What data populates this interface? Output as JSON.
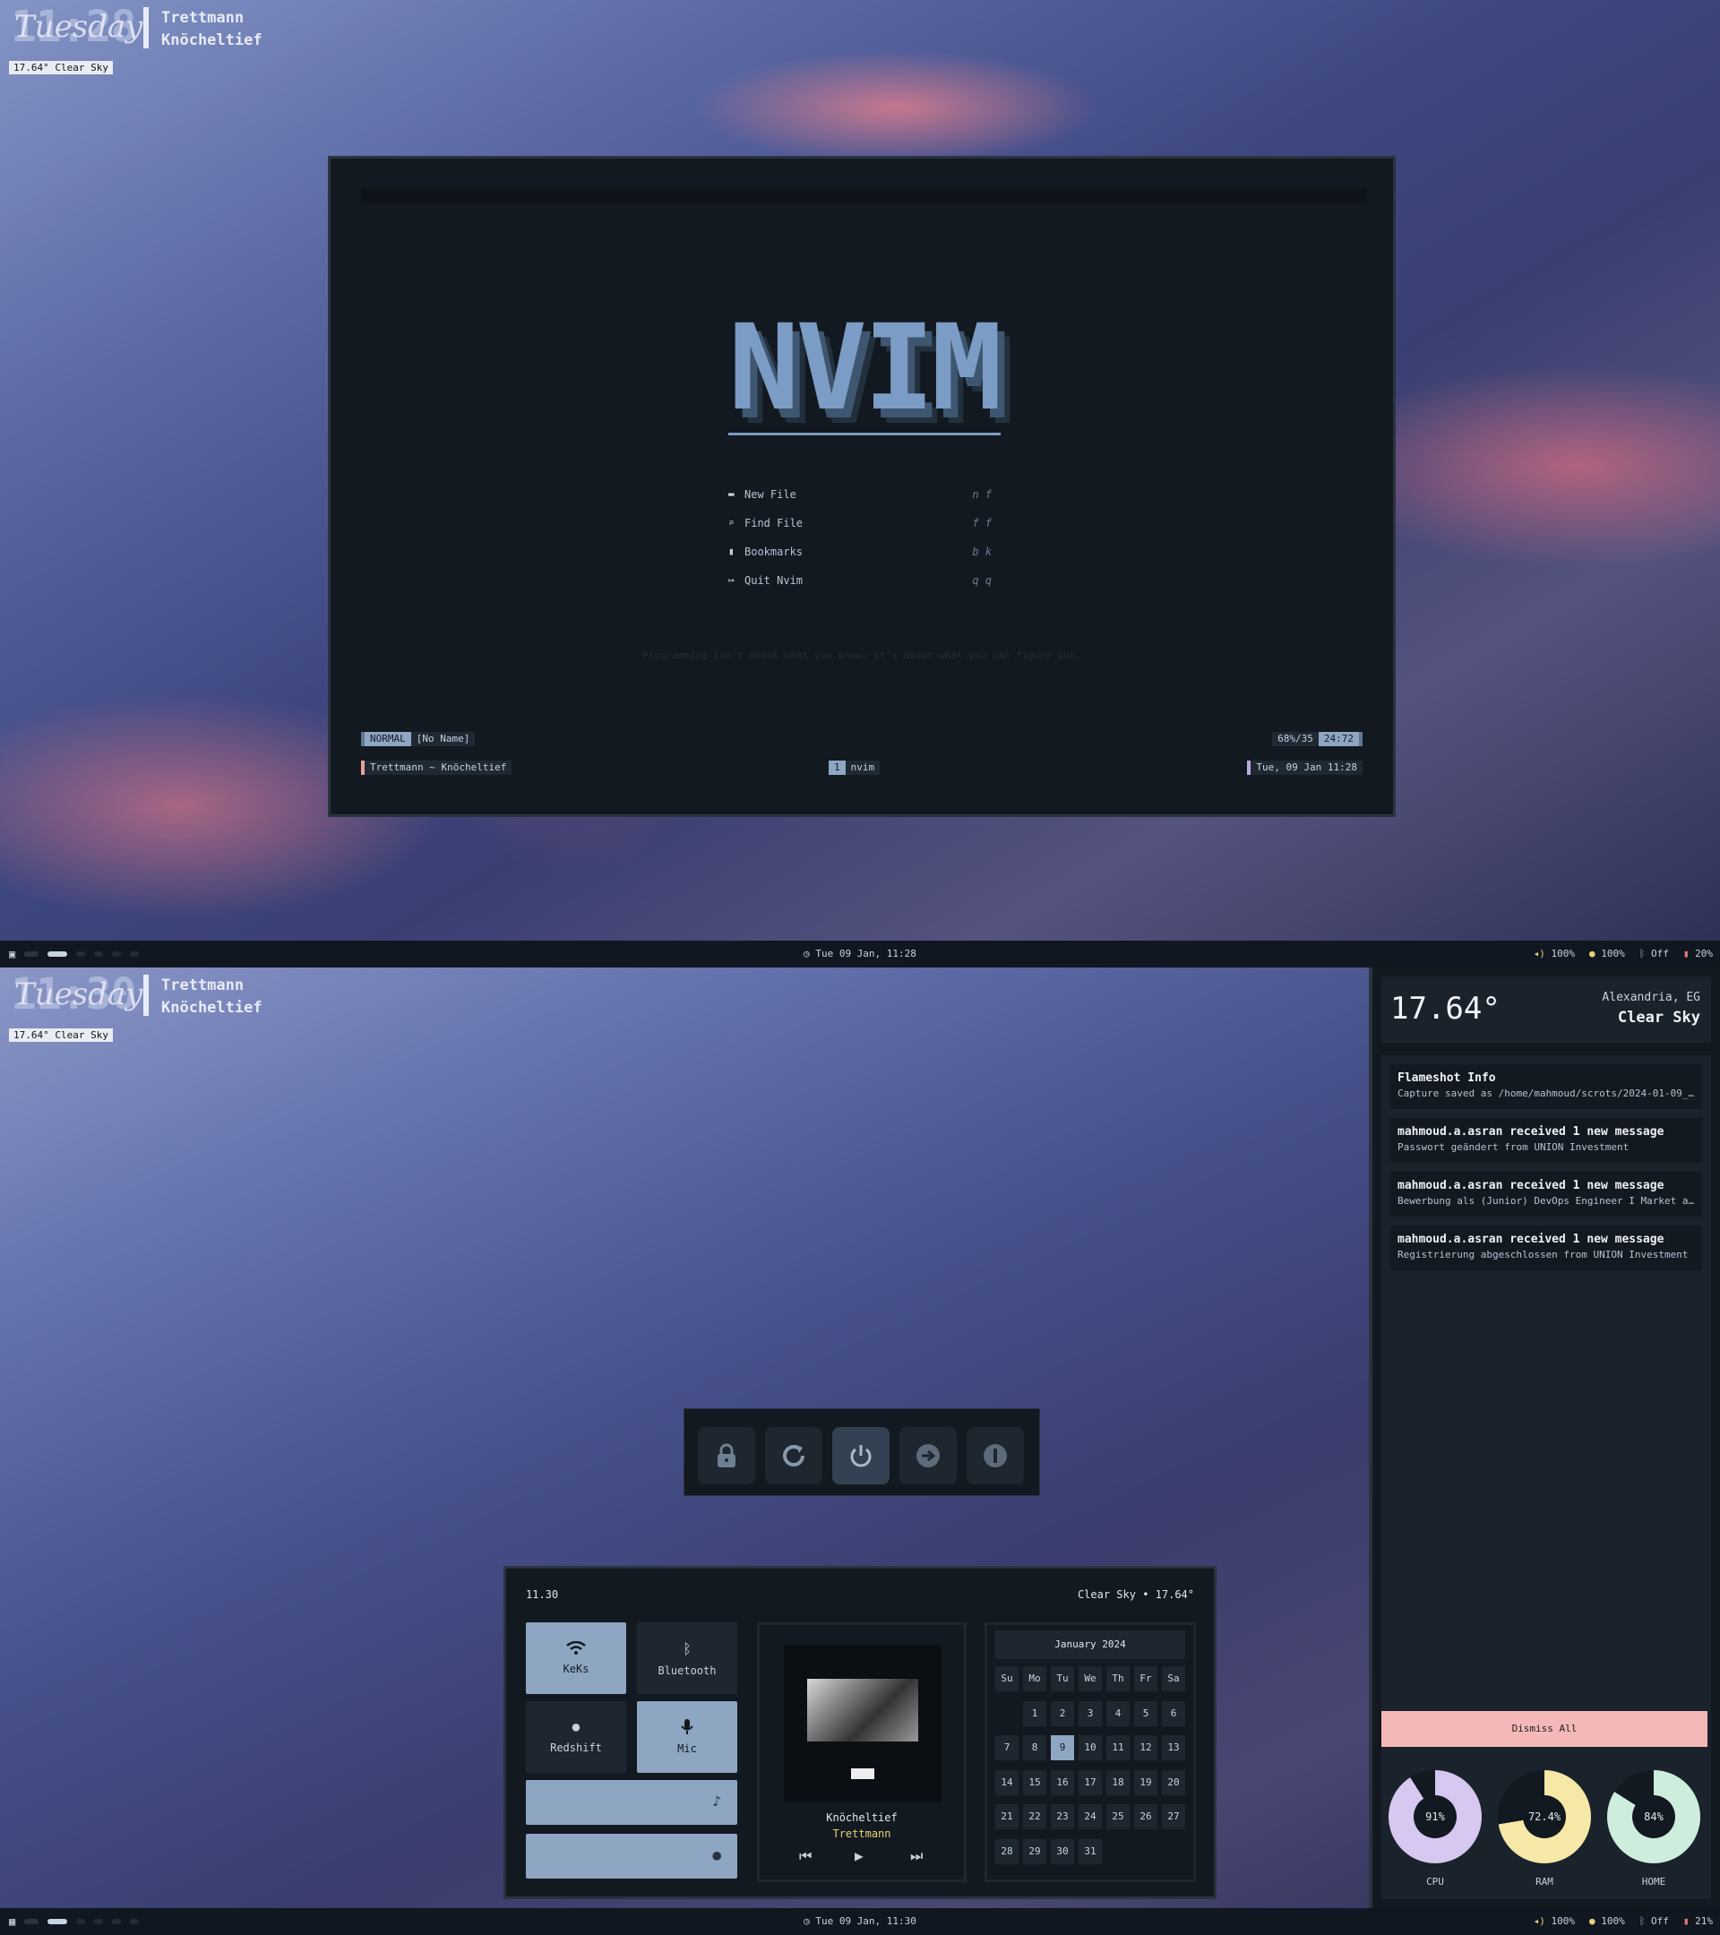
{
  "desktop": {
    "top": {
      "time": "11:28",
      "day": "Tuesday",
      "song_title": "Trettmann",
      "song_artist": "Knöcheltief",
      "weather": "17.64° Clear Sky"
    },
    "bottom": {
      "time": "11:30",
      "day": "Tuesday",
      "song_title": "Trettmann",
      "song_artist": "Knöcheltief",
      "weather": "17.64° Clear Sky"
    }
  },
  "nvim": {
    "logo": "NVIM",
    "menu": [
      {
        "icon": "folder-icon",
        "glyph": "▬",
        "label": "New File",
        "key": "n f"
      },
      {
        "icon": "search-icon",
        "glyph": "⌕",
        "label": "Find File",
        "key": "f f"
      },
      {
        "icon": "bookmark-icon",
        "glyph": "▮",
        "label": "Bookmarks",
        "key": "b k"
      },
      {
        "icon": "quit-icon",
        "glyph": "↦",
        "label": "Quit Nvim",
        "key": "q q"
      }
    ],
    "quote": "Programming isn't about what you know; it's about what you can figure out.",
    "statusline": {
      "mode": "NORMAL",
      "file": "[No Name]",
      "percent": "68%/35",
      "position": "24:72"
    },
    "tmuxline": {
      "session": "Trettmann ~ Knöcheltief",
      "window_index": "1",
      "window_name": "nvim",
      "datetime": "Tue, 09 Jan   11:28"
    }
  },
  "bar_top": {
    "clock": "Tue 09 Jan, 11:28",
    "volume": "100%",
    "brightness": "100%",
    "bluetooth": "Off",
    "battery": "20%"
  },
  "bar_bottom": {
    "clock": "Tue 09 Jan, 11:30",
    "volume": "100%",
    "brightness": "100%",
    "bluetooth": "Off",
    "battery": "21%"
  },
  "power_menu": [
    "lock-icon",
    "reboot-icon",
    "shutdown-icon",
    "logout-icon",
    "suspend-icon"
  ],
  "dashboard": {
    "time": "11.30",
    "weather": "Clear Sky • 17.64°",
    "tiles": {
      "wifi": "KeKs",
      "bluetooth": "Bluetooth",
      "redshift": "Redshift",
      "mic": "Mic"
    },
    "player": {
      "title": "Knöcheltief",
      "artist": "Trettmann"
    },
    "calendar": {
      "title": "January 2024",
      "weekdays": [
        "Su",
        "Mo",
        "Tu",
        "We",
        "Th",
        "Fr",
        "Sa"
      ],
      "start_offset": 1,
      "days": 31,
      "selected": 9
    }
  },
  "sidebar": {
    "temp": "17.64°",
    "location": "Alexandria, EG",
    "condition": "Clear Sky",
    "notifications": [
      {
        "title": "Flameshot Info",
        "body": "Capture saved as /home/mahmoud/scrots/2024-01-09_11-..."
      },
      {
        "title": "mahmoud.a.asran received 1 new message",
        "body": "Passwort geändert from UNION Investment"
      },
      {
        "title": "mahmoud.a.asran received 1 new message",
        "body": "Bewerbung als (Junior) DevOps Engineer I Market and ..."
      },
      {
        "title": "mahmoud.a.asran received 1 new message",
        "body": "Registrierung abgeschlossen from UNION Investment"
      }
    ],
    "dismiss": "Dismiss All",
    "gauges": [
      {
        "label": "CPU",
        "text": "91%",
        "value": 91,
        "color": "#d6c8f0"
      },
      {
        "label": "RAM",
        "text": "72.4%",
        "value": 72.4,
        "color": "#f6e8a6"
      },
      {
        "label": "HOME",
        "text": "84%",
        "value": 84,
        "color": "#cdeedc"
      }
    ]
  },
  "colors": {
    "accent": "#8ea6c2",
    "background": "#131920",
    "dismiss": "#f4b8b8"
  }
}
